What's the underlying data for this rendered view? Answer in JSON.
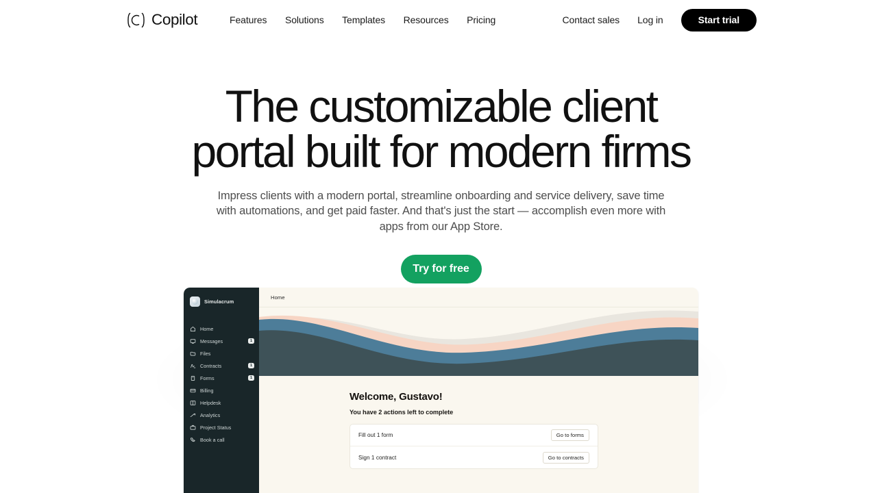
{
  "brand": {
    "name": "Copilot",
    "logo_icon": "copilot-c-mark"
  },
  "nav": {
    "main_links": [
      {
        "label": "Features"
      },
      {
        "label": "Solutions"
      },
      {
        "label": "Templates"
      },
      {
        "label": "Resources"
      },
      {
        "label": "Pricing"
      }
    ],
    "right_links": [
      {
        "label": "Contact sales"
      },
      {
        "label": "Log in"
      }
    ],
    "cta_label": "Start trial"
  },
  "hero": {
    "title_line_1": "The customizable client",
    "title_line_2": "portal built for modern firms",
    "subtitle": "Impress clients with a modern portal, streamline onboarding and service delivery, save time with automations, and get paid faster. And that's just the start — accomplish even more with apps from our App Store.",
    "cta_label": "Try for free",
    "cta_color": "#13a160"
  },
  "app_mockup": {
    "workspace": {
      "name": "Simulacrum",
      "avatar_icon": "workspace-avatar"
    },
    "sidebar_items": [
      {
        "label": "Home",
        "icon": "home-icon",
        "badge": ""
      },
      {
        "label": "Messages",
        "icon": "chat-bubble-icon",
        "badge": "1"
      },
      {
        "label": "Files",
        "icon": "folder-icon",
        "badge": ""
      },
      {
        "label": "Contracts",
        "icon": "signature-icon",
        "badge": "1"
      },
      {
        "label": "Forms",
        "icon": "clipboard-icon",
        "badge": "1"
      },
      {
        "label": "Billing",
        "icon": "credit-card-icon",
        "badge": ""
      },
      {
        "label": "Helpdesk",
        "icon": "book-icon",
        "badge": ""
      },
      {
        "label": "Analytics",
        "icon": "trend-line-icon",
        "badge": ""
      },
      {
        "label": "Project Status",
        "icon": "briefcase-icon",
        "badge": ""
      },
      {
        "label": "Book a call",
        "icon": "phone-icon",
        "badge": ""
      }
    ],
    "breadcrumb": "Home",
    "banner": {
      "background_color": "#faf7ef",
      "wave_colors": [
        "#e9e6df",
        "#f7d5c4",
        "#4d7d99",
        "#3e5258"
      ]
    },
    "welcome_title": "Welcome, Gustavo!",
    "welcome_subtitle": "You have 2 actions left to complete",
    "actions": [
      {
        "text": "Fill out 1 form",
        "button_label": "Go to forms"
      },
      {
        "text": "Sign 1 contract",
        "button_label": "Go to contracts"
      }
    ]
  }
}
